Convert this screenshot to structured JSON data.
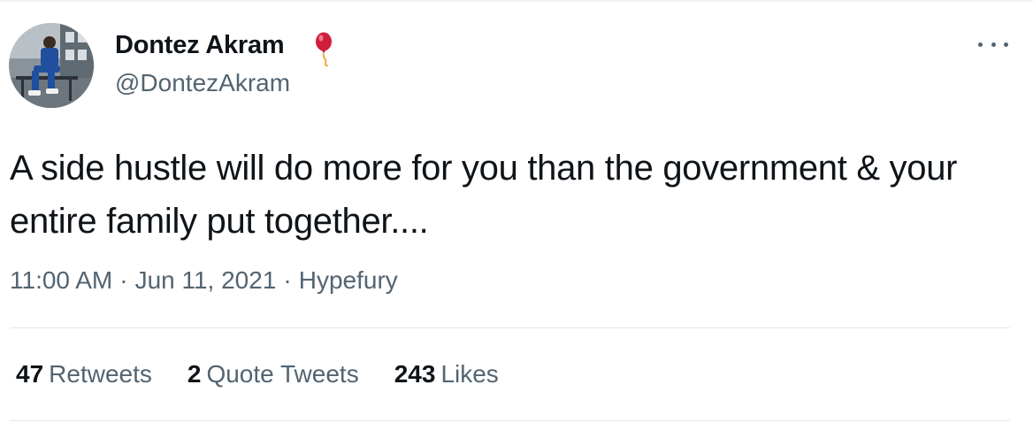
{
  "tweet": {
    "author": {
      "display_name": "Dontez Akram",
      "handle": "@DontezAkram",
      "name_emoji_icon": "balloon-icon"
    },
    "text": "A side hustle will do more for you than the government & your entire family put together....",
    "time": "11:00 AM",
    "date": "Jun 11, 2021",
    "source": "Hypefury",
    "separator": "·",
    "menu_icon": "more-horizontal-icon"
  },
  "stats": {
    "retweets": {
      "count": "47",
      "label": "Retweets"
    },
    "quote_tweets": {
      "count": "2",
      "label": "Quote Tweets"
    },
    "likes": {
      "count": "243",
      "label": "Likes"
    }
  },
  "colors": {
    "primary_text": "#0f1419",
    "secondary_text": "#536471",
    "divider": "#e1e8ed",
    "balloon": "#d01f3c"
  }
}
